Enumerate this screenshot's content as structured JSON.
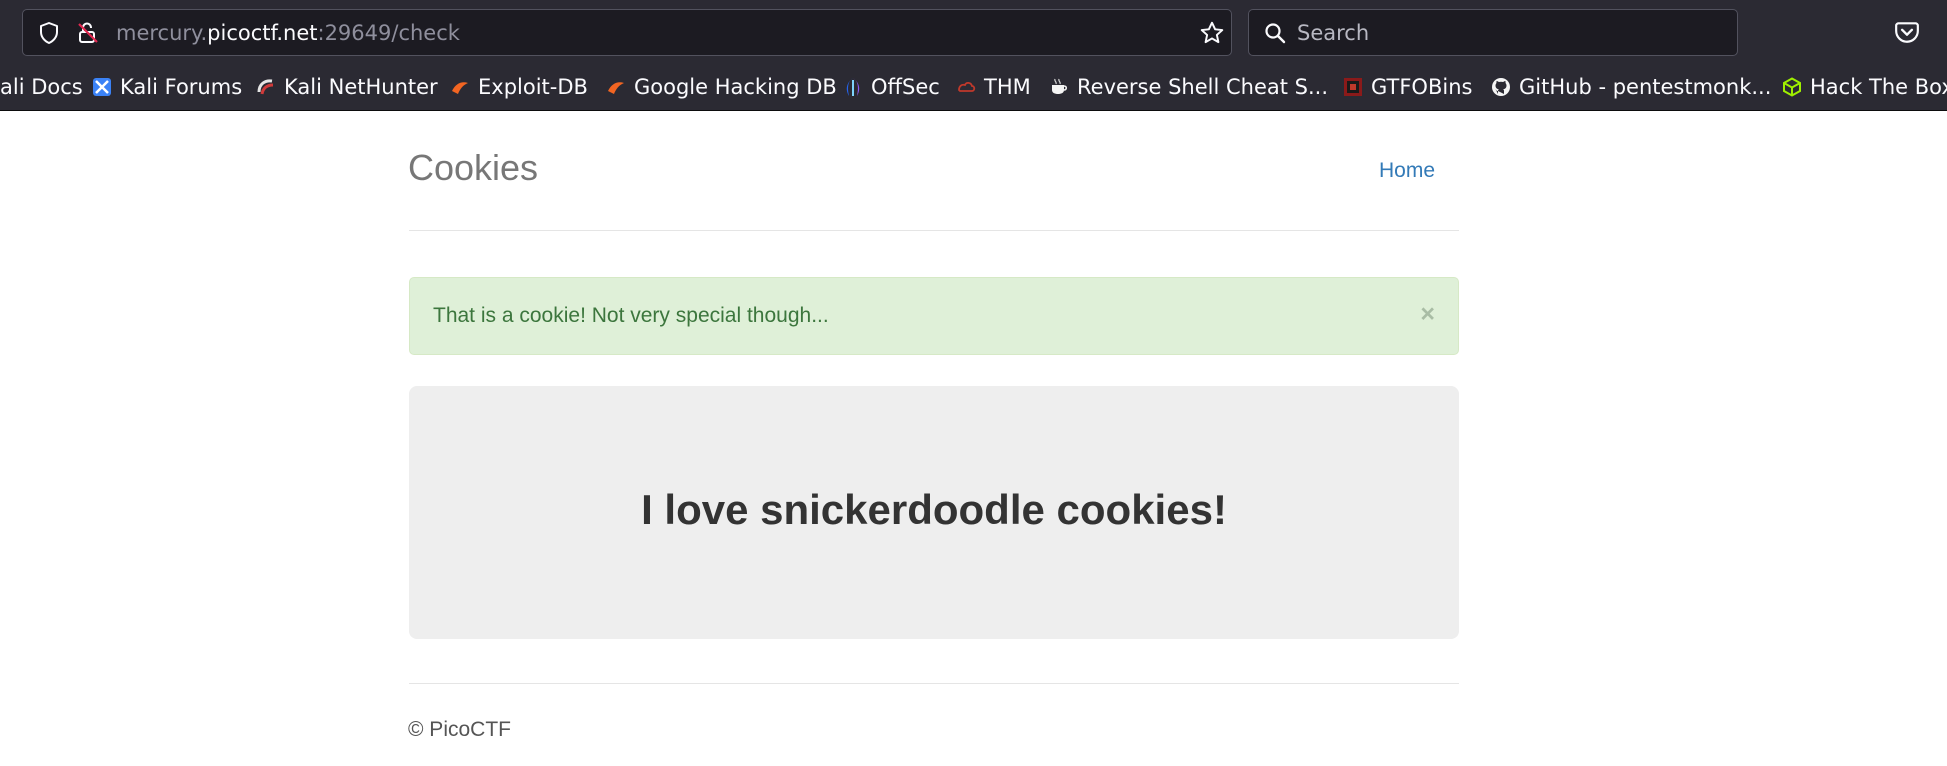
{
  "browser": {
    "url_host_prefix": "mercury.",
    "url_host_main": "picoctf.net",
    "url_rest": ":29649/check",
    "search_placeholder": "Search"
  },
  "bookmarks": [
    {
      "label": "ali Docs",
      "icon": "kali-docs-icon"
    },
    {
      "label": "Kali Forums",
      "icon": "kali-forums-icon"
    },
    {
      "label": "Kali NetHunter",
      "icon": "kali-nethunter-icon"
    },
    {
      "label": "Exploit-DB",
      "icon": "exploit-db-icon"
    },
    {
      "label": "Google Hacking DB",
      "icon": "ghdb-icon"
    },
    {
      "label": "OffSec",
      "icon": "offsec-icon"
    },
    {
      "label": "THM",
      "icon": "thm-icon"
    },
    {
      "label": "Reverse Shell Cheat S...",
      "icon": "coffee-cup-icon"
    },
    {
      "label": "GTFOBins",
      "icon": "gtfobins-icon"
    },
    {
      "label": "GitHub - pentestmonk...",
      "icon": "github-icon"
    },
    {
      "label": "Hack The Box",
      "icon": "htb-cube-icon"
    }
  ],
  "page": {
    "brand": "Cookies",
    "nav_home": "Home",
    "alert_text": "That is a cookie! Not very special though...",
    "alert_close": "×",
    "jumbotron_heading": "I love snickerdoodle cookies!",
    "footer": "© PicoCTF"
  },
  "colors": {
    "chrome_bg": "#2b2a33",
    "alert_bg": "#dff0d8",
    "alert_text": "#3c763d",
    "link": "#337ab7",
    "jumbotron_bg": "#eeeeee"
  }
}
